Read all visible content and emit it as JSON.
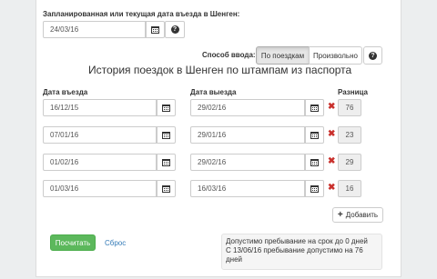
{
  "planned_date": {
    "label": "Запланированная или текущая дата въезда в Шенген:",
    "value": "24/03/16"
  },
  "input_mode": {
    "label": "Способ ввода:",
    "options": [
      "По поездкам",
      "Произвольно"
    ],
    "selected": "По поездкам"
  },
  "history_title": "История поездок в Шенген по штампам из паспорта",
  "columns": {
    "entry": "Дата въезда",
    "exit": "Дата выезда",
    "diff": "Разница"
  },
  "trips": [
    {
      "entry": "16/12/15",
      "exit": "29/02/16",
      "diff": "76"
    },
    {
      "entry": "07/01/16",
      "exit": "29/01/16",
      "diff": "23"
    },
    {
      "entry": "01/02/16",
      "exit": "29/02/16",
      "diff": "29"
    },
    {
      "entry": "01/03/16",
      "exit": "16/03/16",
      "diff": "16"
    }
  ],
  "add_button": "Добавить",
  "calculate_button": "Посчитать",
  "reset_link": "Сброс",
  "result": {
    "line1": "Допустимо пребывание на срок до 0 дней",
    "line2": "С 13/06/16 пребывание допустимо на 76",
    "line3": "дней"
  },
  "icons": {
    "calendar": "calendar-icon",
    "help": "question-circle-icon",
    "remove": "remove-icon",
    "add": "plus-icon"
  },
  "colors": {
    "primary_button": "#5cb85c",
    "link": "#337ab7",
    "remove": "#c9302c"
  }
}
